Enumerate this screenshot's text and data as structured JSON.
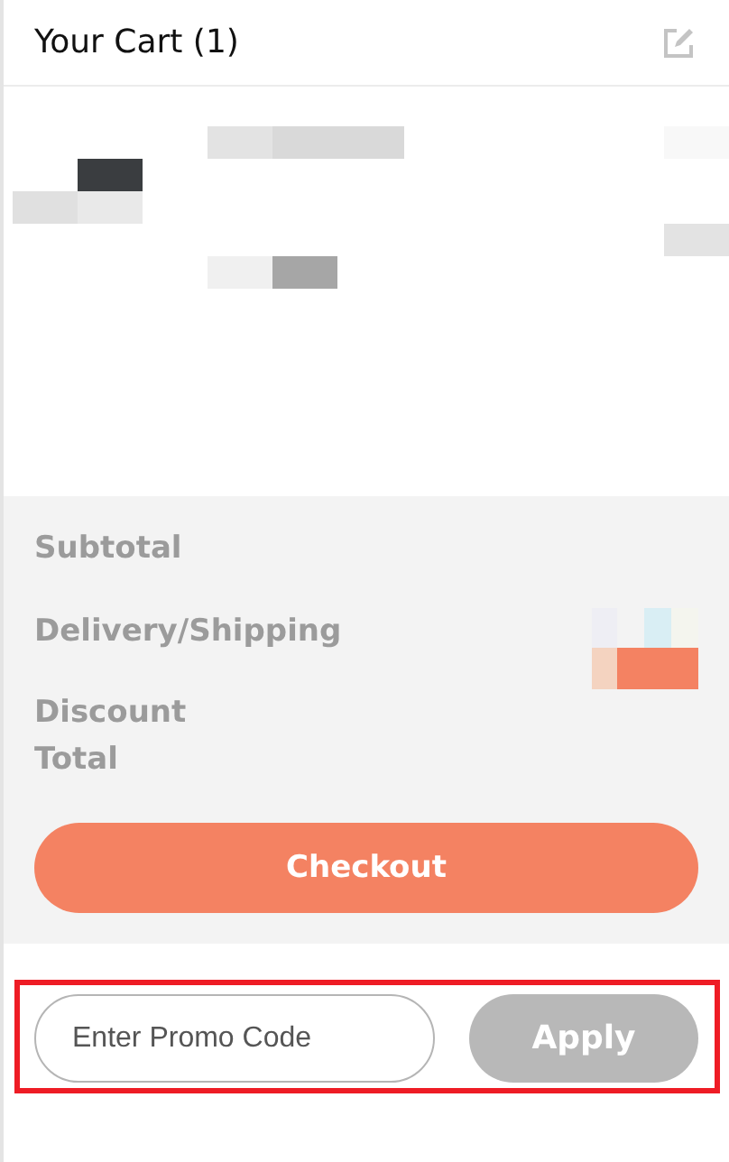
{
  "header": {
    "title": "Your Cart (1)"
  },
  "summary": {
    "rows": [
      {
        "label": "Subtotal"
      },
      {
        "label": "Delivery/Shipping"
      },
      {
        "label": "Discount"
      },
      {
        "label": "Total"
      }
    ],
    "checkout": "Checkout"
  },
  "promo": {
    "placeholder": "Enter Promo Code",
    "apply": {
      "label": "Apply",
      "disabled": true
    },
    "highlighted": true
  }
}
